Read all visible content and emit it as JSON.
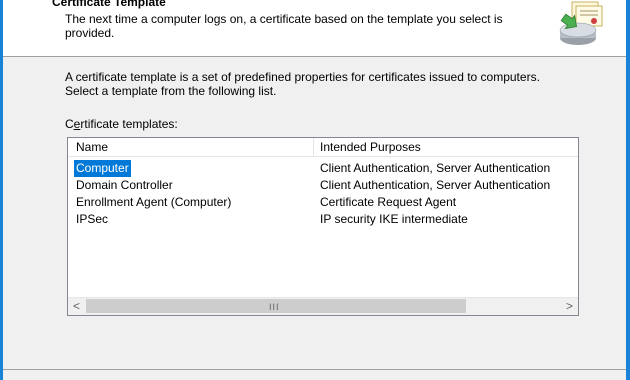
{
  "header": {
    "title": "Certificate Template",
    "description": "The next time a computer logs on, a certificate based on the template you select is provided."
  },
  "body": {
    "intro": "A certificate template is a set of predefined properties for certificates issued to computers. Select a template from the following list.",
    "list_label_prefix": "C",
    "list_label_access": "e",
    "list_label_suffix": "rtificate templates:"
  },
  "list": {
    "columns": [
      "Name",
      "Intended Purposes"
    ],
    "rows": [
      {
        "name": "Computer",
        "purposes": "Client Authentication, Server Authentication"
      },
      {
        "name": "Domain Controller",
        "purposes": "Client Authentication, Server Authentication"
      },
      {
        "name": "Enrollment Agent (Computer)",
        "purposes": "Certificate Request Agent"
      },
      {
        "name": "IPSec",
        "purposes": "IP security IKE intermediate"
      }
    ],
    "selected_index": 0
  },
  "scrollbar": {
    "left_arrow": "<",
    "right_arrow": ">",
    "grip": "III"
  },
  "colors": {
    "selection": "#0078d7",
    "window_frame": "#1883d7"
  },
  "icons": [
    "certificate-wizard-icon"
  ]
}
